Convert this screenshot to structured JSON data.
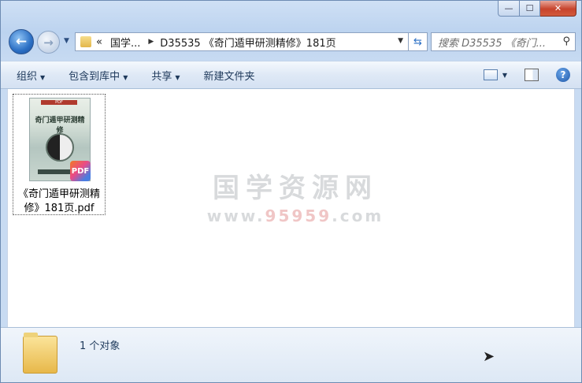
{
  "window": {
    "caption": {
      "minimize": "—",
      "maximize": "☐",
      "close": "✕"
    }
  },
  "nav": {
    "back_icon": "back-arrow-icon",
    "forward_icon": "forward-arrow-icon",
    "address": {
      "overflow": "«",
      "segment1": "国学...",
      "segment2": "D35535 《奇门遁甲研测精修》181页"
    },
    "search": {
      "placeholder": "搜索 D35535 《奇门..."
    }
  },
  "toolbar": {
    "organize": "组织",
    "include_in_library": "包含到库中",
    "share": "共享",
    "new_folder": "新建文件夹"
  },
  "files": [
    {
      "name_line1": "《奇门遁甲研测精",
      "name_line2": "修》181页.pdf",
      "thumb_title": "奇门遁甲研测精修",
      "badge": "PDF"
    }
  ],
  "watermark": {
    "line1": "国学资源网",
    "line2_a": "www.",
    "line2_b": "95959",
    "line2_c": ".com"
  },
  "status": {
    "count_text": "1 个对象"
  },
  "colors": {
    "accent": "#2b6fc4",
    "close": "#c7432c"
  }
}
